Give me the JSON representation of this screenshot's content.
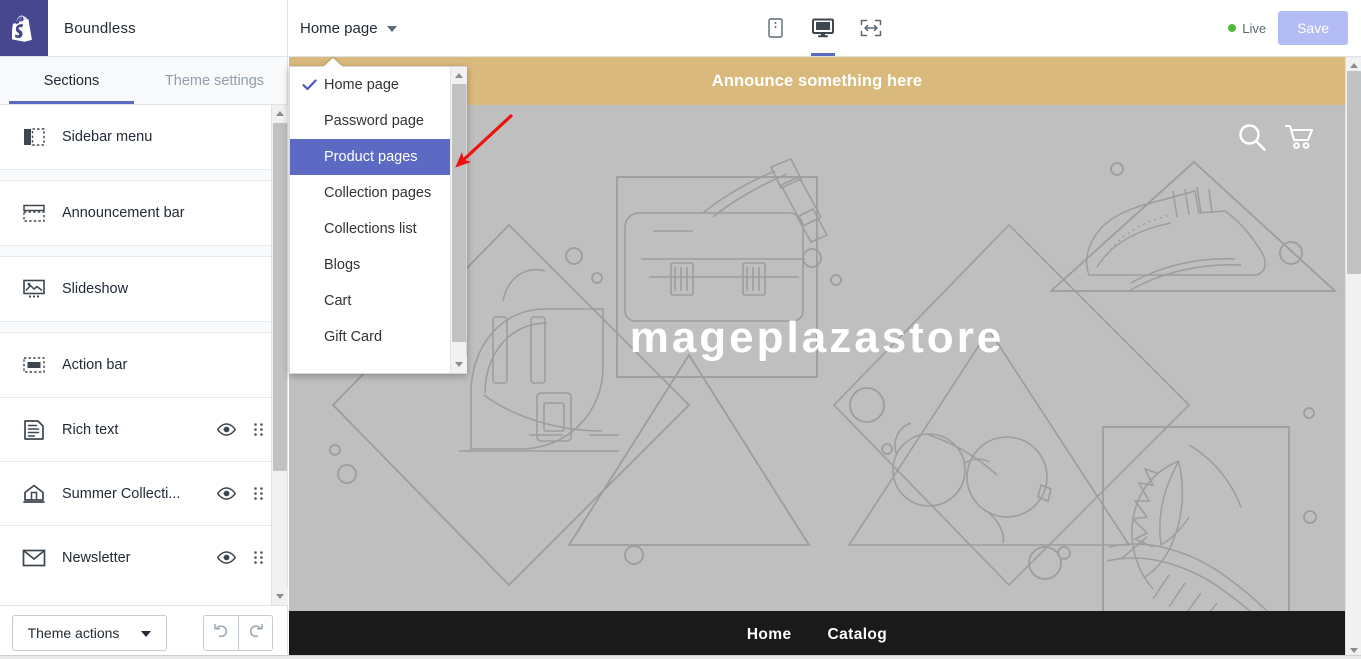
{
  "topbar": {
    "logo_icon": "shopify-bag-icon",
    "theme_name": "Boundless",
    "page_selector": {
      "label": "Home page",
      "caret_icon": "chevron-down-icon"
    },
    "devices": [
      {
        "name": "mobile",
        "icon": "mobile-device-icon",
        "active": false
      },
      {
        "name": "desktop",
        "icon": "desktop-device-icon",
        "active": true
      },
      {
        "name": "fullwidth",
        "icon": "full-width-icon",
        "active": false
      }
    ],
    "status": {
      "label": "Live",
      "dot_color": "#50b83c"
    },
    "save_label": "Save",
    "save_color": "#b3bcf5"
  },
  "sidebar": {
    "tabs": [
      {
        "label": "Sections",
        "active": true
      },
      {
        "label": "Theme settings",
        "active": false
      }
    ],
    "sections": [
      {
        "label": "Sidebar menu",
        "icon": "sidebar-menu-icon",
        "eye": false,
        "drag": false
      },
      {
        "label": "Announcement bar",
        "icon": "announcement-bar-icon",
        "eye": false,
        "drag": false
      },
      {
        "label": "Slideshow",
        "icon": "slideshow-icon",
        "eye": false,
        "drag": false
      },
      {
        "label": "Action bar",
        "icon": "action-bar-icon",
        "eye": false,
        "drag": false
      },
      {
        "label": "Rich text",
        "icon": "rich-text-icon",
        "eye": true,
        "drag": true
      },
      {
        "label": "Summer Collecti...",
        "icon": "collection-icon",
        "eye": true,
        "drag": true
      },
      {
        "label": "Newsletter",
        "icon": "newsletter-icon",
        "eye": true,
        "drag": true
      }
    ],
    "footer": {
      "theme_actions_label": "Theme actions",
      "theme_actions_caret": "caret-down-icon",
      "undo_icon": "undo-icon",
      "redo_icon": "redo-icon"
    }
  },
  "page_dropdown": {
    "items": [
      {
        "label": "Home page",
        "checked": true,
        "selected": false
      },
      {
        "label": "Password page",
        "checked": false,
        "selected": false
      },
      {
        "label": "Product pages",
        "checked": false,
        "selected": true
      },
      {
        "label": "Collection pages",
        "checked": false,
        "selected": false
      },
      {
        "label": "Collections list",
        "checked": false,
        "selected": false
      },
      {
        "label": "Blogs",
        "checked": false,
        "selected": false
      },
      {
        "label": "Cart",
        "checked": false,
        "selected": false
      },
      {
        "label": "Gift Card",
        "checked": false,
        "selected": false
      }
    ],
    "highlight_color": "#5c6ac4",
    "check_icon": "check-icon"
  },
  "preview": {
    "announcement": {
      "text": "Announce something here",
      "background": "#dab97c"
    },
    "header_icons": [
      {
        "name": "search-icon"
      },
      {
        "name": "cart-icon"
      }
    ],
    "store_title": "mageplazastore",
    "background_color": "#bfbfbf",
    "footer_nav": [
      {
        "label": "Home"
      },
      {
        "label": "Catalog"
      }
    ],
    "footer_background": "#1a1a1a"
  },
  "annotation": {
    "type": "arrow",
    "color": "#ee1111",
    "points_to": "Product pages"
  }
}
